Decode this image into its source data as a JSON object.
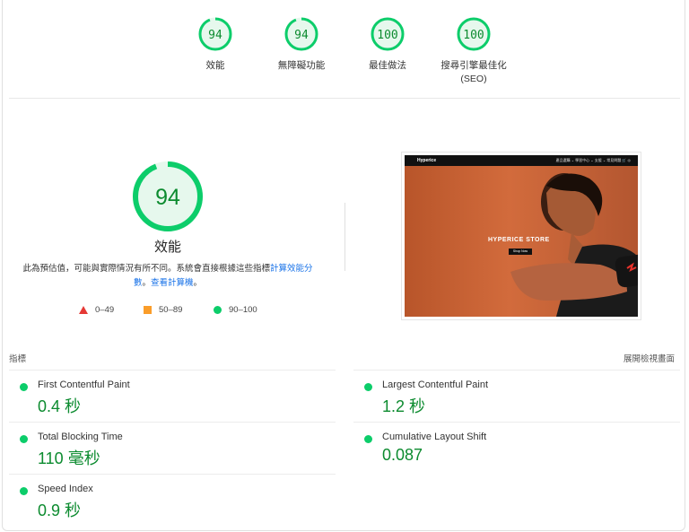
{
  "gauges": [
    {
      "score": "94",
      "label": "效能",
      "value": 94
    },
    {
      "score": "94",
      "label": "無障礙功能",
      "value": 94
    },
    {
      "score": "100",
      "label": "最佳做法",
      "value": 100
    },
    {
      "score": "100",
      "label": "搜尋引擎最佳化",
      "label2": "(SEO)",
      "value": 100
    }
  ],
  "main": {
    "score": "94",
    "value": 94,
    "title": "效能",
    "desc_text": "此為預估值，可能與實際情況有所不同。系統會直接根據這些指標",
    "link1": "計算效能分數",
    "desc_mid": "。",
    "link2": "查看計算機",
    "desc_end": "。"
  },
  "legend": {
    "fail": "0–49",
    "average": "50–89",
    "pass": "90–100"
  },
  "screenshot": {
    "nav_logo": "Hyperice",
    "nav_links": "產品選購 ⌄   學習中心 ⌄   支援 ⌄   常見問題   🛒   ◎",
    "hero_title": "HYPERICE STORE",
    "hero_button": "Shop Now"
  },
  "metrics": {
    "header": "指標",
    "expand_label": "展開檢視畫面",
    "fcp": {
      "name": "First Contentful Paint",
      "value": "0.4 秒"
    },
    "lcp": {
      "name": "Largest Contentful Paint",
      "value": "1.2 秒"
    },
    "tbt": {
      "name": "Total Blocking Time",
      "value": "110 毫秒"
    },
    "cls": {
      "name": "Cumulative Layout Shift",
      "value": "0.087"
    },
    "si": {
      "name": "Speed Index",
      "value": "0.9 秒"
    }
  },
  "colors": {
    "pass": "#0ccd6a",
    "pass_text": "#0c8b2f",
    "average": "#fa9d2a",
    "fail": "#e53935",
    "link": "#1a73e8"
  }
}
